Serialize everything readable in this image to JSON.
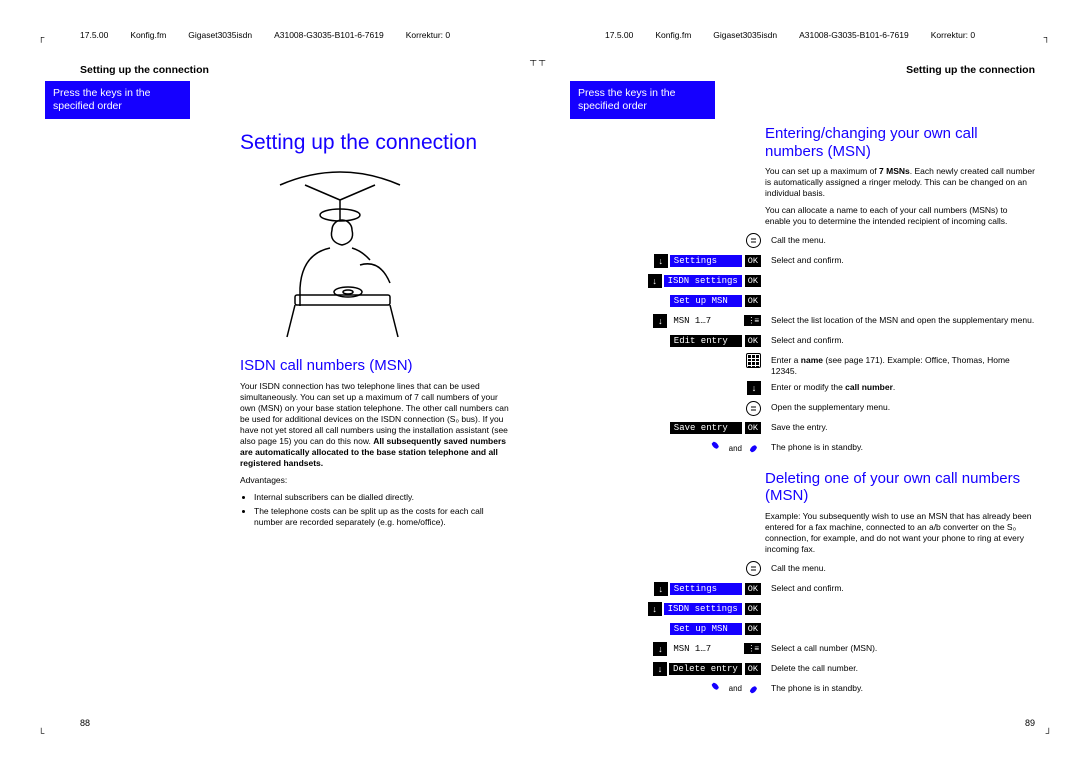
{
  "header": {
    "date": "17.5.00",
    "file": "Konfig.fm",
    "product": "Gigaset3035isdn",
    "docnum": "A31008-G3035-B101-6-7619",
    "kor": "Korrektur: 0"
  },
  "left": {
    "sectionhead": "Setting up the connection",
    "bluebar": "Press the keys in the specified order",
    "title": "Setting up the connection",
    "sub1": "ISDN call numbers (MSN)",
    "p1": "Your ISDN connection has two telephone lines that can be used simultaneously. You can set up a maximum of 7 call numbers of your own (MSN) on your base station telephone. The other call numbers can be used for additional devices on the ISDN connection (S₀ bus). If you have not yet stored all call numbers using the installation assistant (see also page 15) you can do this now. ",
    "p1b": "All subsequently saved numbers are automatically allocated to the base station telephone and all registered handsets.",
    "advlabel": "Advantages:",
    "adv1": "Internal subscribers can be dialled directly.",
    "adv2": "The telephone costs can be split up as the costs for each call number are recorded separately (e.g. home/office).",
    "pagenum": "88"
  },
  "right": {
    "sectionhead": "Setting up the connection",
    "bluebar": "Press the keys in the specified order",
    "sub1": "Entering/changing your own call numbers (MSN)",
    "p1a": "You can set up a maximum of ",
    "p1b": "7 MSNs",
    "p1c": ". Each newly created call number is automatically assigned a ringer melody. This can be changed on an individual basis.",
    "p2": "You can allocate a name to each of your call numbers (MSNs) to enable you to determine the intended recipient of incoming calls.",
    "steps1": [
      {
        "key": "menu-icon",
        "desc": "Call the menu."
      },
      {
        "key": "arrow|blue:Settings|OK",
        "desc": "Select and confirm."
      },
      {
        "key": "arrow|blue:ISDN settings|OK",
        "desc": ""
      },
      {
        "key": "blue:Set up MSN|OK",
        "desc": ""
      },
      {
        "key": "arrow|light:MSN 1…7|dots",
        "desc": "Select the list location of the MSN and open the supplementary menu."
      },
      {
        "key": "black:Edit entry|OK",
        "desc": "Select and confirm."
      },
      {
        "key": "keypad",
        "desc_html": "Enter a <b>name</b> (see page 171). Example: Office, Thomas, Home 12345."
      },
      {
        "key": "arrow",
        "desc_html": "Enter or modify the <b>call number</b>."
      },
      {
        "key": "menu-icon",
        "desc": "Open the supplementary menu."
      },
      {
        "key": "black:Save entry|OK",
        "desc": "Save the entry."
      },
      {
        "key": "phone-and-phone",
        "desc": "The phone is in standby."
      }
    ],
    "sub2": "Deleting one of your own call numbers (MSN)",
    "p3": "Example: You subsequently wish to use an MSN that has already been entered for a fax machine, connected to an a/b converter on the S₀ connection, for example, and do not want your phone to ring at every incoming fax.",
    "steps2": [
      {
        "key": "menu-icon",
        "desc": "Call the menu."
      },
      {
        "key": "arrow|blue:Settings|OK",
        "desc": "Select and confirm."
      },
      {
        "key": "arrow|blue:ISDN settings|OK",
        "desc": ""
      },
      {
        "key": "blue:Set up MSN|OK",
        "desc": ""
      },
      {
        "key": "arrow|light:MSN 1…7|dots",
        "desc": "Select a call number (MSN)."
      },
      {
        "key": "arrow|black:Delete entry|OK",
        "desc": "Delete the call number."
      },
      {
        "key": "phone-and-phone",
        "desc": "The phone is in standby."
      }
    ],
    "pagenum": "89"
  },
  "labels": {
    "ok": "OK",
    "and": "and"
  }
}
